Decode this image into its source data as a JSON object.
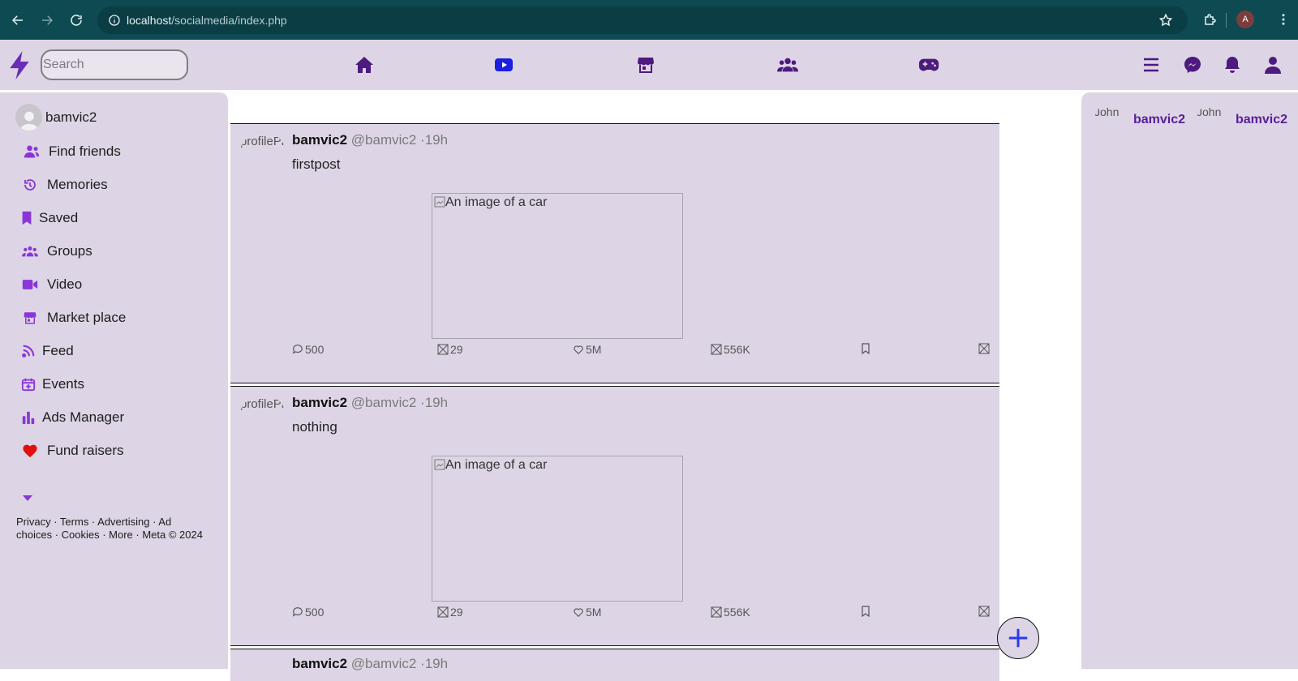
{
  "browser": {
    "url_host": "localhost",
    "url_path": "/socialmedia/index.php",
    "profile_initial": "A"
  },
  "header": {
    "search_placeholder": "Search"
  },
  "sidebar": {
    "user_name": "bamvic2",
    "items": [
      {
        "label": "Find friends",
        "icon": "friends-icon"
      },
      {
        "label": "Memories",
        "icon": "history-icon"
      },
      {
        "label": "Saved",
        "icon": "bookmark-icon"
      },
      {
        "label": "Groups",
        "icon": "groups-icon"
      },
      {
        "label": "Video",
        "icon": "video-icon"
      },
      {
        "label": "Market place",
        "icon": "store-icon"
      },
      {
        "label": "Feed",
        "icon": "rss-icon"
      },
      {
        "label": "Events",
        "icon": "calendar-icon"
      },
      {
        "label": "Ads Manager",
        "icon": "chart-icon"
      },
      {
        "label": "Fund raisers",
        "icon": "heart-icon"
      }
    ],
    "footer": "Privacy · Terms · Advertising · Ad choices · Cookies · More · Meta © 2024"
  },
  "posts": [
    {
      "avatar_alt": "profilePic",
      "name": "bamvic2",
      "handle": "@bamvic2 ·19h",
      "text": "firstpost",
      "image_alt": "An image of a car",
      "comments": "500",
      "reposts": "29",
      "likes": "5M",
      "views": "556K"
    },
    {
      "avatar_alt": "profilePic",
      "name": "bamvic2",
      "handle": "@bamvic2 ·19h",
      "text": "nothing",
      "image_alt": "An image of a car",
      "comments": "500",
      "reposts": "29",
      "likes": "5M",
      "views": "556K"
    },
    {
      "name": "bamvic2",
      "handle": "@bamvic2 ·19h"
    }
  ],
  "contacts": [
    {
      "pic_alt": "John",
      "name": "bamvic2"
    },
    {
      "pic_alt": "John",
      "name": "bamvic2"
    }
  ],
  "colors": {
    "chrome": "#0d4a52",
    "panel": "#ddd5e5",
    "accent": "#8a35d8",
    "header_icon": "#4d1a7f",
    "fab": "#2a3af0"
  }
}
